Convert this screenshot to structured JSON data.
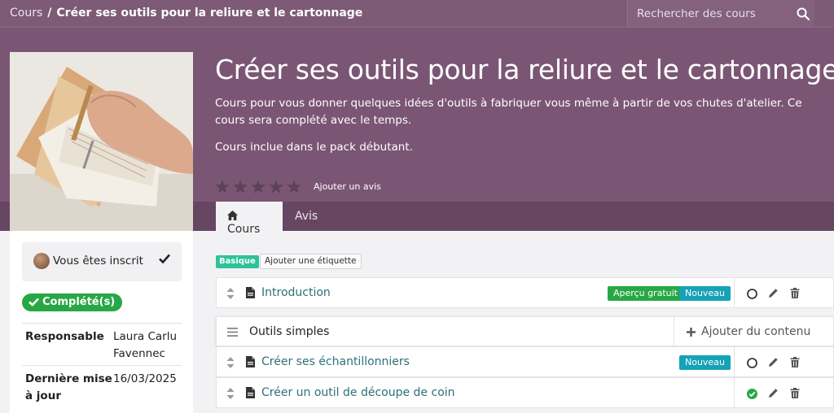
{
  "breadcrumb": {
    "root": "Cours",
    "separator": "/",
    "current": "Créer ses outils pour la reliure et le cartonnage"
  },
  "search": {
    "placeholder": "Rechercher des cours"
  },
  "course": {
    "title": "Créer ses outils pour la reliure et le cartonnage",
    "description": "Cours pour vous donner quelques idées d'outils à fabriquer vous même à partir de vos chutes d'atelier. Ce cours sera complété avec le temps.",
    "note": "Cours inclue dans le pack débutant.",
    "rating": 0,
    "rating_max": 5,
    "add_review": "Ajouter un avis"
  },
  "tabs": [
    {
      "label": "Cours",
      "icon": "home-icon",
      "active": true
    },
    {
      "label": "Avis",
      "active": false
    }
  ],
  "sidebar": {
    "enrolled_label": "Vous êtes inscrit",
    "completed_label": "Complété(s)",
    "info": [
      {
        "key": "Responsable",
        "value": "Laura Carlu Favennec"
      },
      {
        "key": "Dernière mise à jour",
        "value": "16/03/2025"
      }
    ]
  },
  "tags": {
    "basic": "Basique",
    "add_tag": "Ajouter une étiquette"
  },
  "content": {
    "intro": {
      "name": "Introduction",
      "badges": [
        "Aperçu gratuit",
        "Nouveau"
      ],
      "done": false
    },
    "section": {
      "name": "Outils simples",
      "add_label": "Ajouter du contenu"
    },
    "items": [
      {
        "name": "Créer ses échantillonniers",
        "badges": [
          "Nouveau"
        ],
        "done": false
      },
      {
        "name": "Créer un outil de découpe de coin",
        "badges": [],
        "done": true
      }
    ]
  },
  "colors": {
    "hero": "#7b5674",
    "accent": "#2b7178",
    "success": "#28a745",
    "info": "#17a2b8"
  }
}
